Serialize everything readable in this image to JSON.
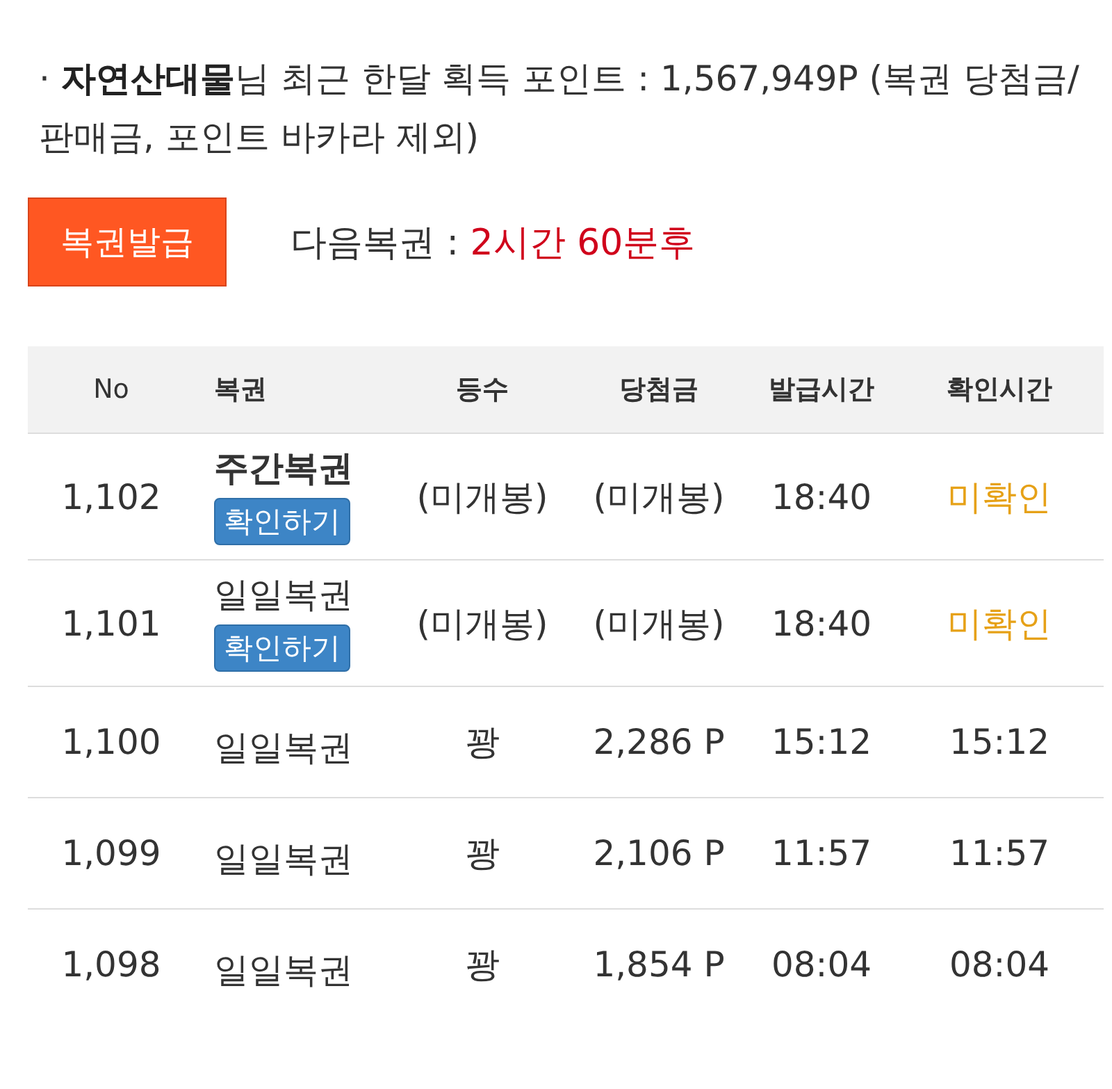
{
  "summary": {
    "text": "· **자연산대물**님 최근 한달 획득 포인트 : 1,567,949P (복권 당첨금/판매금, 포인트 바카라 제외)"
  },
  "issue_button": {
    "label": "복권발급"
  },
  "next_lottery": {
    "label": "다음복권 : ",
    "time": "2시간 60분후"
  },
  "table": {
    "columns": [
      "No",
      "복권",
      "등수",
      "당첨금",
      "발급시간",
      "확인시간"
    ],
    "rows": [
      {
        "kind": "unopened",
        "no": "1,102",
        "name": "주간복권",
        "bold": true,
        "button": "확인하기",
        "rank": "(미개봉)",
        "prize": "(미개봉)",
        "issued": "18:40",
        "checked": "미확인",
        "confirmed": false
      },
      {
        "kind": "unopened",
        "no": "1,101",
        "name": "일일복권",
        "bold": false,
        "button": "확인하기",
        "rank": "(미개봉)",
        "prize": "(미개봉)",
        "issued": "18:40",
        "checked": "미확인",
        "confirmed": false
      },
      {
        "kind": "opened",
        "no": "1,100",
        "name": "일일복권",
        "bold": false,
        "rank": "꽝",
        "prize": "2,286 P",
        "issued": "15:12",
        "checked": "15:12",
        "confirmed": true
      },
      {
        "kind": "opened",
        "no": "1,099",
        "name": "일일복권",
        "bold": false,
        "rank": "꽝",
        "prize": "2,106 P",
        "issued": "11:57",
        "checked": "11:57",
        "confirmed": true
      },
      {
        "kind": "opened",
        "no": "1,098",
        "name": "일일복권",
        "bold": false,
        "rank": "꽝",
        "prize": "1,854 P",
        "issued": "08:04",
        "checked": "08:04",
        "confirmed": true
      }
    ]
  }
}
